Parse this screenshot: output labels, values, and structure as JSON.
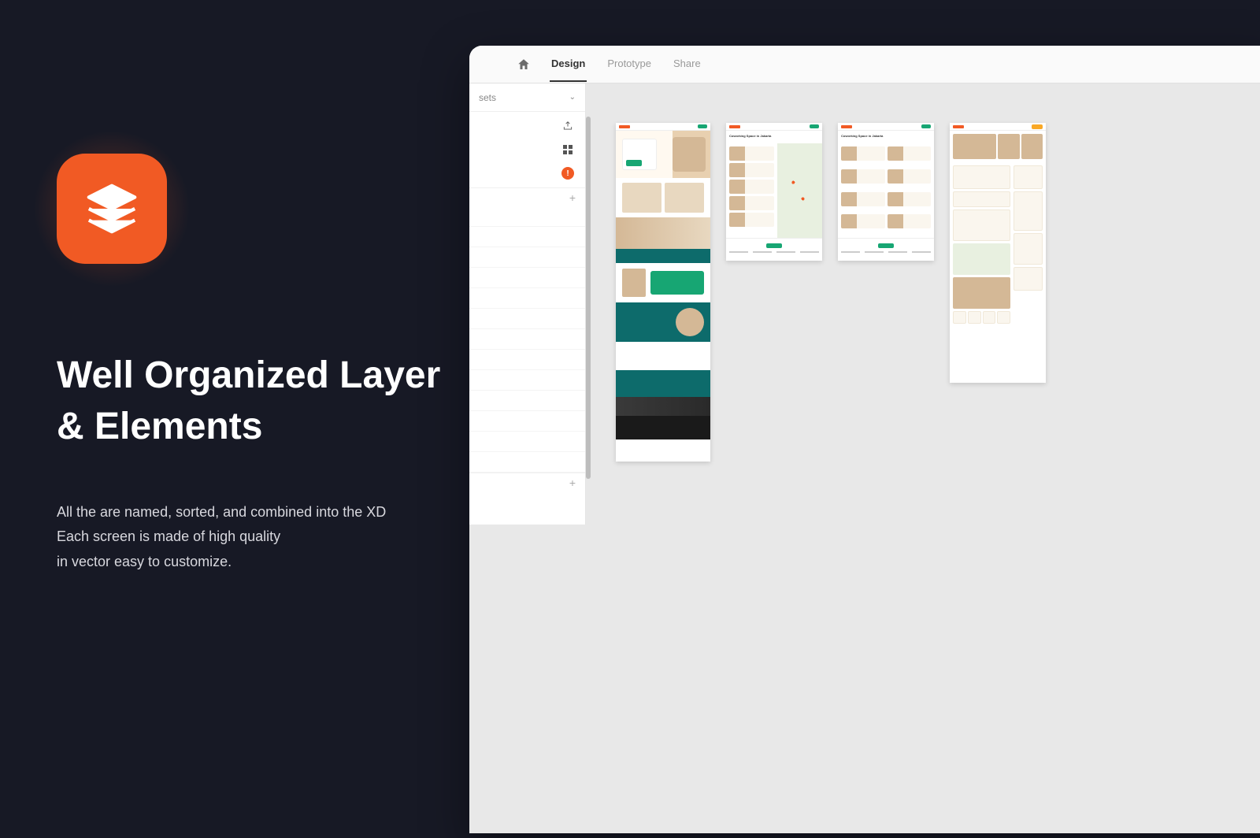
{
  "promo": {
    "heading_line1": "Well Organized Layer",
    "heading_line2": "& Elements",
    "desc_line1": "All the are named, sorted, and combined into the XD",
    "desc_line2": "Each screen is made of high quality",
    "desc_line3": "in vector easy to customize."
  },
  "xd": {
    "tabs": {
      "design": "Design",
      "prototype": "Prototype",
      "share": "Share"
    },
    "panel": {
      "assets_label": "sets",
      "warn": "!"
    },
    "canvas": {
      "heading_ab2": "Coworking Space in Jakarta",
      "heading_ab3": "Coworking Space in Jakarta"
    }
  },
  "colors": {
    "accent": "#f15a24",
    "teal": "#0d6b6b",
    "green": "#17a673"
  }
}
